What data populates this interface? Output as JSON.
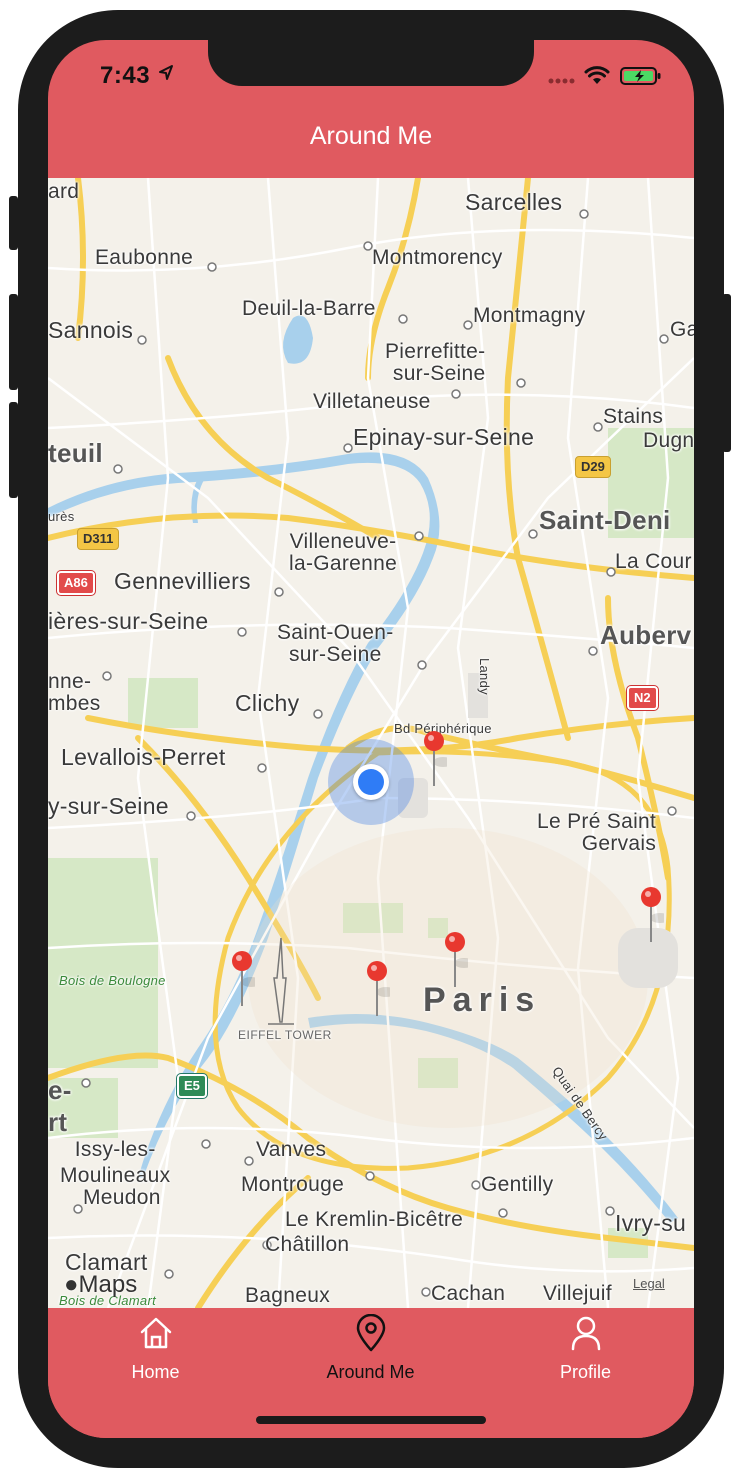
{
  "status_bar": {
    "time": "7:43"
  },
  "navbar": {
    "title": "Around Me"
  },
  "map": {
    "labels": {
      "sarcelles": "Sarcelles",
      "eaubonne": "Eaubonne",
      "montmorency": "Montmorency",
      "deuil": "Deuil-la-Barre",
      "montmagny": "Montmagny",
      "sannois": "Sannois",
      "ga": "Ga",
      "pierrefitte": "Pierrefitte-\nsur-Seine",
      "villetaneuse": "Villetaneuse",
      "stains": "Stains",
      "dugn": "Dugn",
      "epinay": "Epinay-sur-Seine",
      "teuil": "teuil",
      "ard": "ard",
      "ures": "urès",
      "saint_denis": "Saint-Deni",
      "villeneuve": "Villeneuve-\nla-Garenne",
      "la_cour": "La Cour",
      "gennevilliers": "Gennevilliers",
      "ieres": "ières-sur-Seine",
      "saint_ouen": "Saint-Ouen-\nsur-Seine",
      "auberv": "Auberv",
      "landy": "Landy",
      "nne": "nne-\nmbes",
      "clichy": "Clichy",
      "bd_periph": "Bd Périphérique",
      "levallois": "Levallois-Perret",
      "y_sur_seine": "y-sur-Seine",
      "pre_saint_gervais": "Le Pré Saint\nGervais",
      "bois_boulogne": "Bois de Boulogne",
      "eiffel": "EIFFEL TOWER",
      "paris": "Paris",
      "quai_bercy": "Quai de Bercy",
      "e_rt": "e-\nrt",
      "issy": "Issy-les-\nMoulineaux",
      "vanves": "Vanves",
      "meudon": "Meudon",
      "montrouge": "Montrouge",
      "gentilly": "Gentilly",
      "kremlin": "Le Kremlin-Bicêtre",
      "ivry": "Ivry-su",
      "chatillon": "Châtillon",
      "clamart": "Clamart",
      "bois_clamart": "Bois de Clamart",
      "bagneux": "Bagneux",
      "cachan": "Cachan",
      "villejuif": "Villejuif"
    },
    "shields": {
      "d29": "D29",
      "d311": "D311",
      "a86": "A86",
      "n2": "N2",
      "e5": "E5"
    },
    "attribution": {
      "maps_logo": "Maps",
      "legal": "Legal"
    },
    "pin_color": "#e8382f",
    "user_location_color": "#2f7cf6"
  },
  "tabbar": {
    "tabs": [
      {
        "label": "Home",
        "icon": "home-icon"
      },
      {
        "label": "Around Me",
        "icon": "location-pin-icon",
        "active": true
      },
      {
        "label": "Profile",
        "icon": "person-icon"
      }
    ]
  },
  "colors": {
    "accent": "#e05a60",
    "tab_active": "#111111",
    "tab_inactive": "#ffffff"
  }
}
